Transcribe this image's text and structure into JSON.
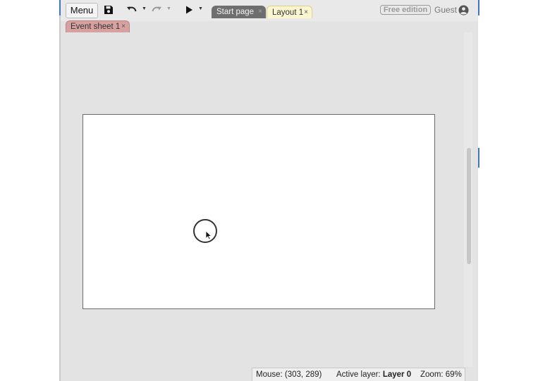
{
  "toolbar": {
    "menu_label": "Menu",
    "icons": [
      "save-icon",
      "undo-icon",
      "redo-icon",
      "play-icon"
    ]
  },
  "tabs": [
    {
      "label": "Start page",
      "active": false
    },
    {
      "label": "Layout 1",
      "active": true
    }
  ],
  "secondary_tabs": [
    {
      "label": "Event sheet 1"
    }
  ],
  "tab_close_glyph": "×",
  "edition_badge": "Free edition",
  "user": {
    "label": "Guest",
    "icon": "user-circle-icon"
  },
  "statusbar": {
    "mouse": "Mouse: (303, 289)",
    "active_layer_label": "Active layer:",
    "active_layer_value": "Layer 0",
    "zoom": "Zoom: 69%"
  },
  "colors": {
    "layout_tab_bg": "#fbf6cf",
    "start_tab_bg": "#6e6e6e",
    "event_tab_bg": "#d7a1a1",
    "accent_blue": "#3f78b8"
  }
}
